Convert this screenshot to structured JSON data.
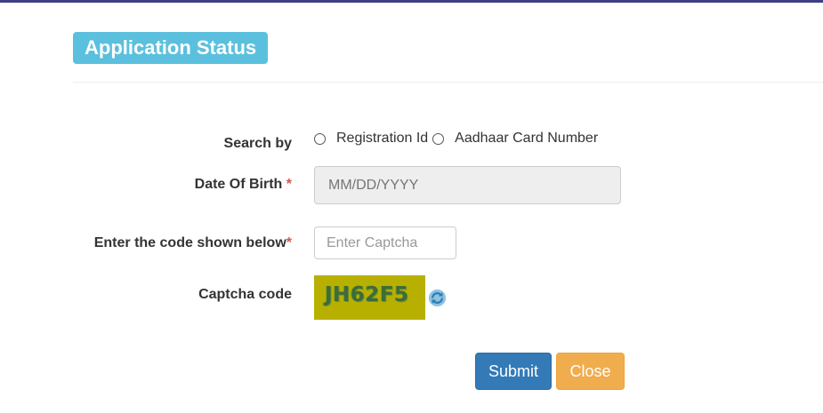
{
  "header": {
    "title": "Application Status"
  },
  "form": {
    "search_by": {
      "label": "Search by",
      "options": [
        "Registration Id",
        "Aadhaar Card Number"
      ]
    },
    "dob": {
      "label": "Date Of Birth",
      "required_mark": "*",
      "placeholder": "MM/DD/YYYY",
      "value": ""
    },
    "captcha_entry": {
      "label": "Enter the code shown below",
      "required_mark": "*",
      "placeholder": "Enter Captcha",
      "value": ""
    },
    "captcha": {
      "label": "Captcha code",
      "code": "JH62F5",
      "refresh_icon": "refresh-icon"
    }
  },
  "actions": {
    "submit_label": "Submit",
    "close_label": "Close"
  },
  "colors": {
    "title_badge": "#5bc0de",
    "submit": "#337ab7",
    "close": "#f0ad4e",
    "captcha_bg": "#b8b000",
    "required": "#d9534f"
  }
}
